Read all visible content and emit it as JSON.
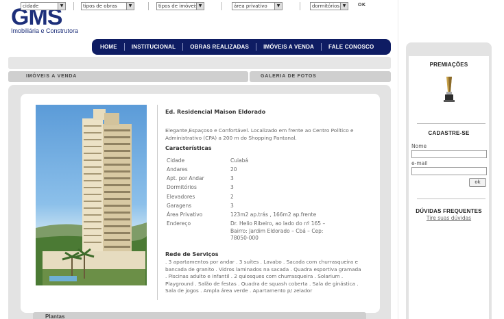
{
  "logo": {
    "name": "GMS",
    "subtitle": "Imobiliária e Construtora"
  },
  "nav": [
    "HOME",
    "INSTITUCIONAL",
    "OBRAS REALIZADAS",
    "IMÓVEIS A VENDA",
    "FALE CONOSCO"
  ],
  "filters": {
    "cidade": "cidade",
    "tipos_obras": "tipos de obras",
    "tipos_imoveis": "tipos de imóveis",
    "area": "área privativo",
    "dormitorios": "dormitórios",
    "ok": "OK"
  },
  "tabs": {
    "imoveis": "IMÓVEIS A VENDA",
    "galeria": "GALERIA DE FOTOS"
  },
  "property": {
    "title": "Ed. Residencial Maison Eldorado",
    "description": "Elegante,Espaçoso e Confortável. Localizado em frente ao Centro Político e Administrativo (CPA) a 200 m do Shopping Pantanal.",
    "characteristics_heading": "Características",
    "specs": [
      {
        "label": "Cidade",
        "value": "Cuiabá"
      },
      {
        "label": "Andares",
        "value": "20"
      },
      {
        "label": "Apt. por Andar",
        "value": "3"
      },
      {
        "label": "Dormitórios",
        "value": "3"
      },
      {
        "label": "Elevadores",
        "value": "2"
      },
      {
        "label": "Garagens",
        "value": "3"
      },
      {
        "label": "Área Privativo",
        "value": "123m2 ap.trás , 166m2 ap.frente"
      },
      {
        "label": "Endereço",
        "value": "Dr. Helio Ribeiro, ao lado do nº 165 – Bairro: Jardim Eldorado – Cbá – Cep: 78050-000"
      }
    ],
    "services_heading": "Rede de Serviços",
    "services": ". 3 apartamentos por andar . 3 suítes . Lavabo . Sacada com churrasqueira e bancada de granito . Vidros laminados na sacada . Quadra esportiva gramada . Piscinas adulto e infantil . 2 quiosques com churrasqueira . Solarium . Playground . Salão de festas . Quadra de squash coberta . Sala de ginástica . Sala de jogos . Ampla área verde . Apartamento p/ zelador"
  },
  "bottom_tab": "Plantas",
  "sidebar": {
    "premiacoes": "PREMIAÇÕES",
    "cadastre": "CADASTRE-SE",
    "nome_label": "Nome",
    "email_label": "e-mail",
    "ok": "ok",
    "faq_heading": "DÚVIDAS FREQUENTES",
    "faq_link": "Tire suas dúvidas"
  },
  "colors": {
    "brand_navy": "#0e1c63",
    "logo_blue": "#1d2f7a",
    "panel_gray": "#e3e3e3"
  }
}
